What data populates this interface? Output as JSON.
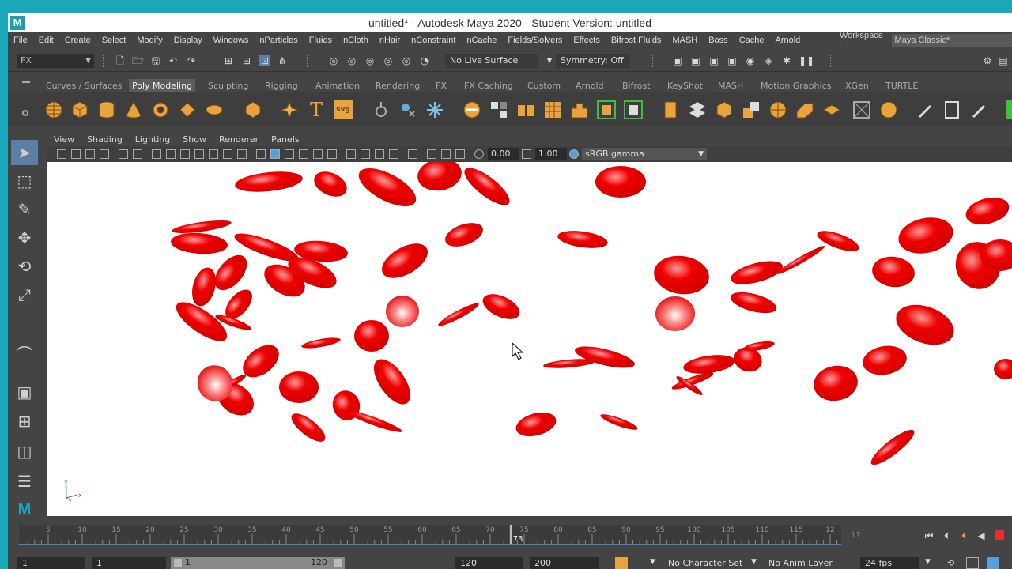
{
  "window": {
    "title": "untitled* - Autodesk Maya 2020 - Student Version: untitled",
    "app_icon_letter": "M"
  },
  "menubar": {
    "items": [
      "File",
      "Edit",
      "Create",
      "Select",
      "Modify",
      "Display",
      "Windows",
      "nParticles",
      "Fluids",
      "nCloth",
      "nHair",
      "nConstraint",
      "nCache",
      "Fields/Solvers",
      "Effects",
      "Bifrost Fluids",
      "MASH",
      "Boss",
      "Cache",
      "Arnold"
    ],
    "workspace_label": "Workspace :",
    "workspace_value": "Maya Classic*"
  },
  "statusline": {
    "mode": "FX",
    "live_surface": "No Live Surface",
    "symmetry": "Symmetry: Off"
  },
  "shelf": {
    "tabs": [
      "Curves / Surfaces",
      "Poly Modeling",
      "Sculpting",
      "Rigging",
      "Animation",
      "Rendering",
      "FX",
      "FX Caching",
      "Custom",
      "Arnold",
      "Bifrost",
      "KeyShot",
      "MASH",
      "Motion Graphics",
      "XGen",
      "TURTLE"
    ],
    "active_tab": "Poly Modeling",
    "text_icons": {
      "type": "T",
      "svg": "svg"
    }
  },
  "panel": {
    "menus": [
      "View",
      "Shading",
      "Lighting",
      "Show",
      "Renderer",
      "Panels"
    ],
    "exposure": "0.00",
    "gamma": "1.00",
    "color_space": "sRGB gamma"
  },
  "viewport": {
    "cell_color": "#ee0000",
    "background": "#ffffff",
    "axis_labels": {
      "y": "y",
      "x": "x"
    }
  },
  "timeslider": {
    "ticks": [
      "5",
      "10",
      "15",
      "20",
      "25",
      "30",
      "35",
      "40",
      "45",
      "50",
      "55",
      "60",
      "65",
      "70",
      "75",
      "80",
      "85",
      "90",
      "95",
      "100",
      "105",
      "110",
      "115",
      "12"
    ],
    "current_frame": "73",
    "end_marker": "11"
  },
  "range": {
    "start": "1",
    "playback_start": "1",
    "slider_start": "1",
    "slider_end": "120",
    "playback_end": "120",
    "end": "200",
    "character_set": "No Character Set",
    "anim_layer": "No Anim Layer",
    "fps": "24 fps"
  }
}
